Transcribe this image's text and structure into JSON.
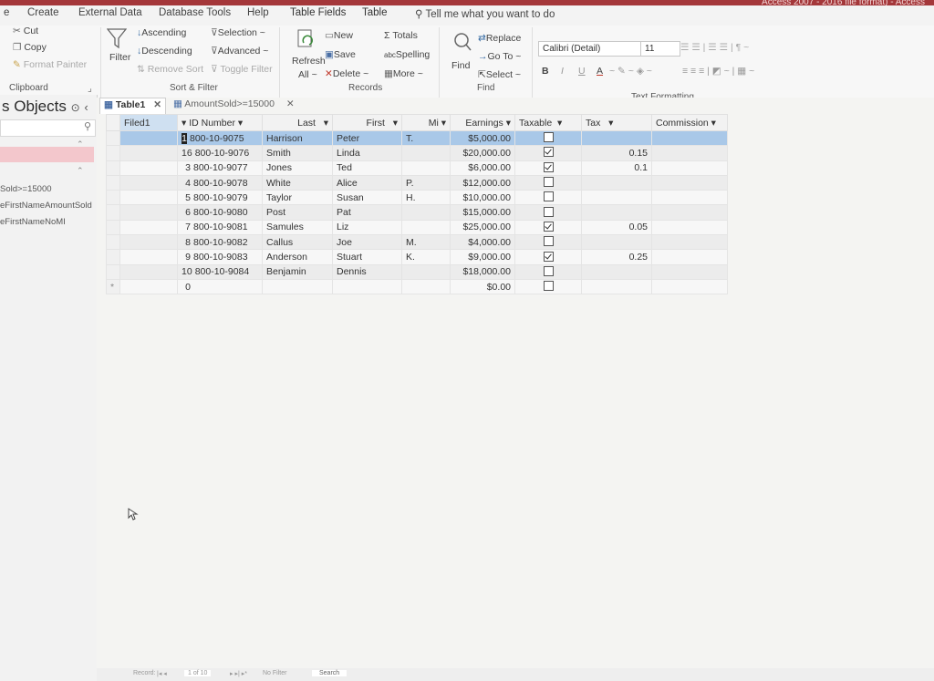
{
  "window": {
    "title": "Access 2007 - 2016 file format)  -  Access"
  },
  "tabs": [
    "e",
    "Create",
    "External Data",
    "Database Tools",
    "Help",
    "Table Fields",
    "Table"
  ],
  "tell_me": "Tell me what you want to do",
  "ribbon": {
    "clipboard": {
      "cut": "Cut",
      "copy": "Copy",
      "format_painter": "Format Painter",
      "group": "Clipboard"
    },
    "sort_filter": {
      "filter": "Filter",
      "ascending": "Ascending",
      "descending": "Descending",
      "remove_sort": "Remove Sort",
      "selection": "Selection ~",
      "advanced": "Advanced ~",
      "toggle_filter": "Toggle Filter",
      "group": "Sort & Filter"
    },
    "records": {
      "refresh": "Refresh",
      "refresh_all": "All ~",
      "new": "New",
      "save": "Save",
      "delete": "Delete",
      "totals": "Totals",
      "spelling": "Spelling",
      "more": "More ~",
      "group": "Records"
    },
    "find": {
      "find": "Find",
      "replace": "Replace",
      "goto": "Go To ~",
      "select": "Select ~",
      "group": "Find"
    },
    "text_formatting": {
      "font": "Calibri (Detail)",
      "size": "11",
      "bold": "B",
      "italic": "I",
      "underline": "U",
      "font_color": "A",
      "group": "Text Formatting"
    }
  },
  "nav": {
    "title": "s Objects",
    "queries": [
      "Sold>=15000",
      "eFirstNameAmountSold",
      "eFirstNameNoMI"
    ]
  },
  "doc_tabs": [
    "Table1",
    "AmountSold>=15000"
  ],
  "datasheet": {
    "columns": [
      "Filed1",
      "ID Number",
      "Last",
      "First",
      "Mi",
      "Earnings",
      "Taxable",
      "Tax",
      "Commission"
    ],
    "rows": [
      {
        "filed1": "",
        "id_prefix": "1",
        "id": "800-10-9075",
        "last": "Harrison",
        "first": "Peter",
        "mi": "T.",
        "earnings": "$5,000.00",
        "taxable": false,
        "tax": "",
        "commission": ""
      },
      {
        "filed1": "",
        "id_prefix": "16",
        "id": "800-10-9076",
        "last": "Smith",
        "first": "Linda",
        "mi": "",
        "earnings": "$20,000.00",
        "taxable": true,
        "tax": "0.15",
        "commission": ""
      },
      {
        "filed1": "",
        "id_prefix": "3",
        "id": "800-10-9077",
        "last": "Jones",
        "first": "Ted",
        "mi": "",
        "earnings": "$6,000.00",
        "taxable": true,
        "tax": "0.1",
        "commission": ""
      },
      {
        "filed1": "",
        "id_prefix": "4",
        "id": "800-10-9078",
        "last": "White",
        "first": "Alice",
        "mi": "P.",
        "earnings": "$12,000.00",
        "taxable": false,
        "tax": "",
        "commission": ""
      },
      {
        "filed1": "",
        "id_prefix": "5",
        "id": "800-10-9079",
        "last": "Taylor",
        "first": "Susan",
        "mi": "H.",
        "earnings": "$10,000.00",
        "taxable": false,
        "tax": "",
        "commission": ""
      },
      {
        "filed1": "",
        "id_prefix": "6",
        "id": "800-10-9080",
        "last": "Post",
        "first": "Pat",
        "mi": "",
        "earnings": "$15,000.00",
        "taxable": false,
        "tax": "",
        "commission": ""
      },
      {
        "filed1": "",
        "id_prefix": "7",
        "id": "800-10-9081",
        "last": "Samules",
        "first": "Liz",
        "mi": "",
        "earnings": "$25,000.00",
        "taxable": true,
        "tax": "0.05",
        "commission": ""
      },
      {
        "filed1": "",
        "id_prefix": "8",
        "id": "800-10-9082",
        "last": "Callus",
        "first": "Joe",
        "mi": "M.",
        "earnings": "$4,000.00",
        "taxable": false,
        "tax": "",
        "commission": ""
      },
      {
        "filed1": "",
        "id_prefix": "9",
        "id": "800-10-9083",
        "last": "Anderson",
        "first": "Stuart",
        "mi": "K.",
        "earnings": "$9,000.00",
        "taxable": true,
        "tax": "0.25",
        "commission": ""
      },
      {
        "filed1": "",
        "id_prefix": "10",
        "id": "800-10-9084",
        "last": "Benjamin",
        "first": "Dennis",
        "mi": "",
        "earnings": "$18,000.00",
        "taxable": false,
        "tax": "",
        "commission": ""
      },
      {
        "filed1": "",
        "id_prefix": "0",
        "id": "",
        "last": "",
        "first": "",
        "mi": "",
        "earnings": "$0.00",
        "taxable": false,
        "tax": "",
        "commission": ""
      }
    ]
  },
  "status": {
    "record": "Record:",
    "position": "1 of 10",
    "filter": "No Filter",
    "search": "Search"
  },
  "colors": {
    "titlebar": "#a4373a",
    "selected_row": "#a9c8e8"
  }
}
